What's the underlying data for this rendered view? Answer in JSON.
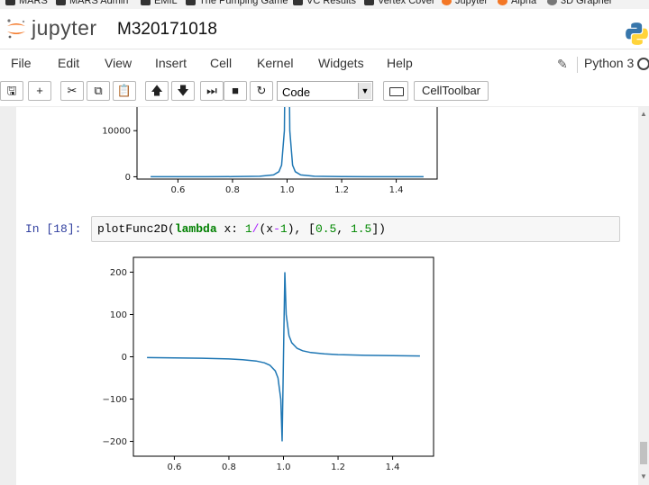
{
  "bookmarks": [
    {
      "label": "MARS",
      "icon": "grad-cap-icon"
    },
    {
      "label": "MARS Admin",
      "icon": "grad-cap-icon"
    },
    {
      "label": "EMIL",
      "icon": "m-icon"
    },
    {
      "label": "The Pumping Game",
      "icon": "grad-cap-icon"
    },
    {
      "label": "VC Results",
      "icon": "grad-cap-icon"
    },
    {
      "label": "Vertex Cover",
      "icon": "grad-cap-icon"
    },
    {
      "label": "Jupyter",
      "icon": "jupyter-icon"
    },
    {
      "label": "Alpha",
      "icon": "alpha-icon"
    },
    {
      "label": "3D Grapher",
      "icon": "globe-icon"
    }
  ],
  "header": {
    "brand": "jupyter",
    "notebook_name": "M320171018",
    "kernel_name": "Python 3"
  },
  "menu": {
    "items": [
      "File",
      "Edit",
      "View",
      "Insert",
      "Cell",
      "Kernel",
      "Widgets",
      "Help"
    ]
  },
  "toolbar": {
    "cell_type": "Code",
    "celltoolbar_label": "CellToolbar",
    "buttons": [
      {
        "name": "save-icon",
        "glyph": "🖫"
      },
      {
        "name": "add-cell-icon",
        "glyph": "+"
      },
      {
        "name": "cut-icon",
        "glyph": "✂"
      },
      {
        "name": "copy-icon",
        "glyph": "⧉"
      },
      {
        "name": "paste-icon",
        "glyph": "📋"
      },
      {
        "name": "move-up-icon",
        "glyph": "🡅"
      },
      {
        "name": "move-down-icon",
        "glyph": "🡇"
      },
      {
        "name": "run-icon",
        "glyph": "⏭"
      },
      {
        "name": "stop-icon",
        "glyph": "■"
      },
      {
        "name": "restart-icon",
        "glyph": "↻"
      }
    ]
  },
  "cell": {
    "prompt": "In [18]:",
    "code_tokens": [
      {
        "t": "plotFunc2D(",
        "c": "pl"
      },
      {
        "t": "lambda",
        "c": "kw"
      },
      {
        "t": " x: ",
        "c": "pl"
      },
      {
        "t": "1",
        "c": "num"
      },
      {
        "t": "/",
        "c": "op"
      },
      {
        "t": "(x",
        "c": "pl"
      },
      {
        "t": "-",
        "c": "op"
      },
      {
        "t": "1",
        "c": "num"
      },
      {
        "t": "), [",
        "c": "pl"
      },
      {
        "t": "0.5",
        "c": "num"
      },
      {
        "t": ", ",
        "c": "pl"
      },
      {
        "t": "1.5",
        "c": "num"
      },
      {
        "t": "])",
        "c": "pl"
      }
    ]
  },
  "chart_data": [
    {
      "type": "line",
      "title": "",
      "xlabel": "",
      "ylabel": "",
      "xlim": [
        0.45,
        1.55
      ],
      "ylim": [
        -500,
        20000
      ],
      "xticks": [
        0.6,
        0.8,
        1.0,
        1.2,
        1.4
      ],
      "xticklabels": [
        "0.6",
        "0.8",
        "1.0",
        "1.2",
        "1.4"
      ],
      "yticks": [
        0,
        10000
      ],
      "yticklabels": [
        "0",
        "10000"
      ],
      "grid": false,
      "color": "#1f77b4",
      "series": [
        {
          "x": [
            0.5,
            0.6,
            0.7,
            0.8,
            0.9,
            0.95,
            0.97,
            0.98,
            0.99,
            0.995,
            1.005,
            1.01,
            1.02,
            1.03,
            1.05,
            1.1,
            1.2,
            1.3,
            1.4,
            1.5
          ],
          "values": [
            4,
            6,
            11,
            25,
            100,
            400,
            1100,
            2500,
            10000,
            40000,
            40000,
            10000,
            2500,
            1100,
            400,
            100,
            25,
            11,
            6,
            4
          ]
        }
      ]
    },
    {
      "type": "line",
      "title": "",
      "xlabel": "",
      "ylabel": "",
      "xlim": [
        0.45,
        1.55
      ],
      "ylim": [
        -235,
        235
      ],
      "xticks": [
        0.6,
        0.8,
        1.0,
        1.2,
        1.4
      ],
      "xticklabels": [
        "0.6",
        "0.8",
        "1.0",
        "1.2",
        "1.4"
      ],
      "yticks": [
        -200,
        -100,
        0,
        100,
        200
      ],
      "yticklabels": [
        "−200",
        "−100",
        "0",
        "100",
        "200"
      ],
      "grid": false,
      "color": "#1f77b4",
      "series": [
        {
          "x": [
            0.5,
            0.6,
            0.7,
            0.8,
            0.85,
            0.9,
            0.93,
            0.95,
            0.97,
            0.98,
            0.99,
            0.995,
            1.005,
            1.01,
            1.02,
            1.03,
            1.05,
            1.07,
            1.1,
            1.15,
            1.2,
            1.3,
            1.4,
            1.5
          ],
          "values": [
            -2,
            -2.5,
            -3.3,
            -5,
            -6.7,
            -10,
            -14.3,
            -20,
            -33.3,
            -50,
            -100,
            -200,
            200,
            100,
            50,
            33.3,
            20,
            14.3,
            10,
            6.7,
            5,
            3.3,
            2.5,
            2
          ]
        }
      ]
    }
  ]
}
